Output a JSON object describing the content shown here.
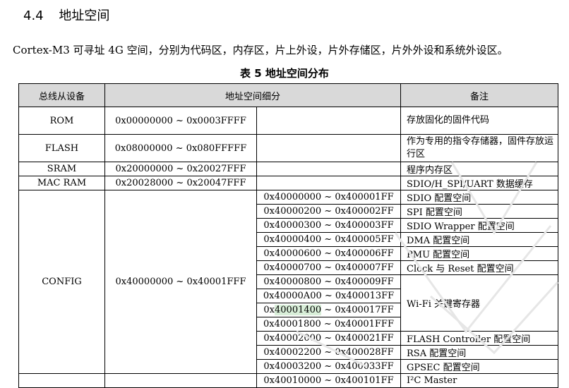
{
  "section": {
    "number": "4.4",
    "title": "地址空间"
  },
  "intro": "Cortex-M3 可寻址 4G 空间，分别为代码区，内存区，片上外设，片外存储区，片外外设和系统外设区。",
  "caption": "表 5 地址空间分布",
  "table": {
    "headers": [
      "总线从设备",
      "地址空间细分",
      "备注"
    ],
    "rows": [
      {
        "device": "ROM",
        "range": "0x00000000 ~ 0x0003FFFF",
        "note": "存放固化的固件代码"
      },
      {
        "device": "FLASH",
        "range": "0x08000000 ~ 0x080FFFFF",
        "note": "作为专用的指令存储器，固件存放运行区"
      },
      {
        "device": "SRAM",
        "range": "0x20000000 ~ 0x20027FFF",
        "note": "程序内存区"
      },
      {
        "device": "MAC RAM",
        "range": "0x20028000 ~ 0x20047FFF",
        "note": "SDIO/H_SPI/UART 数据缓存"
      }
    ],
    "config": {
      "device": "CONFIG",
      "range": "0x40000000 ~ 0x40001FFF",
      "sub": [
        {
          "range": "0x40000000 ~ 0x400001FF",
          "note": "SDIO 配置空间"
        },
        {
          "range": "0x40000200 ~ 0x400002FF",
          "note": "SPI 配置空间"
        },
        {
          "range": "0x40000300 ~ 0x400003FF",
          "note": "SDIO Wrapper 配置空间"
        },
        {
          "range": "0x40000400 ~ 0x400005FF",
          "note": "DMA 配置空间"
        },
        {
          "range": "0x40000600 ~ 0x400006FF",
          "note": "PMU 配置空间"
        },
        {
          "range": "0x40000700 ~ 0x400007FF",
          "note": "Clock 与 Reset 配置空间"
        },
        {
          "range": "0x40000800 ~ 0x400009FF"
        },
        {
          "range": "0x40000A00 ~ 0x400013FF"
        },
        {
          "range_pre": "0x",
          "range_hl": "40001400",
          "range_post": " ~ 0x400017FF"
        },
        {
          "range": "0x40001800 ~ 0x40001FFF"
        },
        {
          "range": "0x40002000 ~ 0x400021FF",
          "note": "FLASH Controller 配置空间"
        },
        {
          "range": "0x40002200 ~ 0x400028FF",
          "note": "RSA 配置空间"
        },
        {
          "range": "0x40003200 ~ 0x400033FF",
          "note": "GPSEC 配置空间"
        }
      ],
      "wifi_note": "Wi-Fi 关键寄存器"
    },
    "last_row": {
      "range": "0x40010000 ~ 0x400101FF",
      "note": "I²C Master"
    }
  }
}
